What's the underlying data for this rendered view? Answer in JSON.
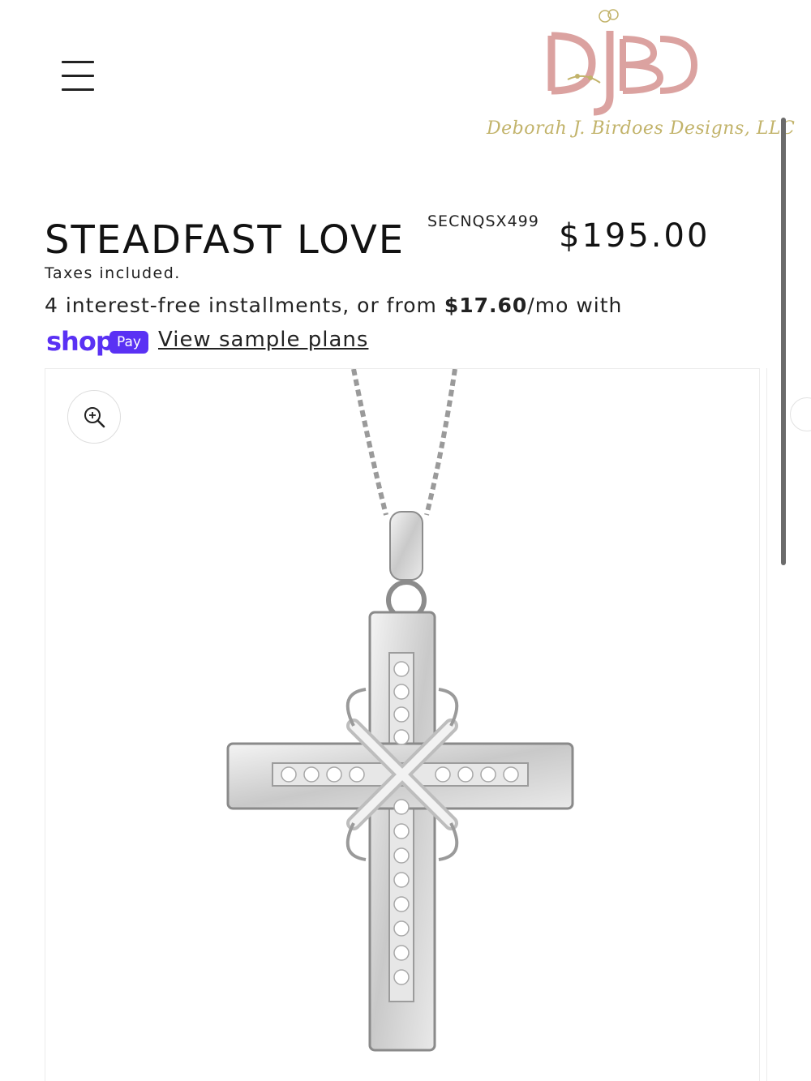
{
  "header": {
    "menu_icon": "hamburger-menu-icon",
    "logo": {
      "monogram": "DJBD",
      "tagline": "Deborah J. Birdoes Designs, LLC",
      "colors": {
        "monogram": "#dba2a0",
        "tagline": "#c2b36a"
      }
    }
  },
  "product": {
    "title": "STEADFAST LOVE",
    "sku": "SECNQSX499",
    "price": "$195.00",
    "taxes_note": "Taxes included.",
    "installments": {
      "prefix": "4 interest-free installments, or from ",
      "amount": "$17.60",
      "suffix": "/mo with"
    },
    "shop_pay": {
      "shop_word": "shop",
      "pay_badge": "Pay",
      "link_text": "View sample plans",
      "color": "#5a31f4"
    }
  },
  "media": {
    "zoom_icon": "zoom-in-icon",
    "image_subject": "silver cross pendant necklace"
  }
}
